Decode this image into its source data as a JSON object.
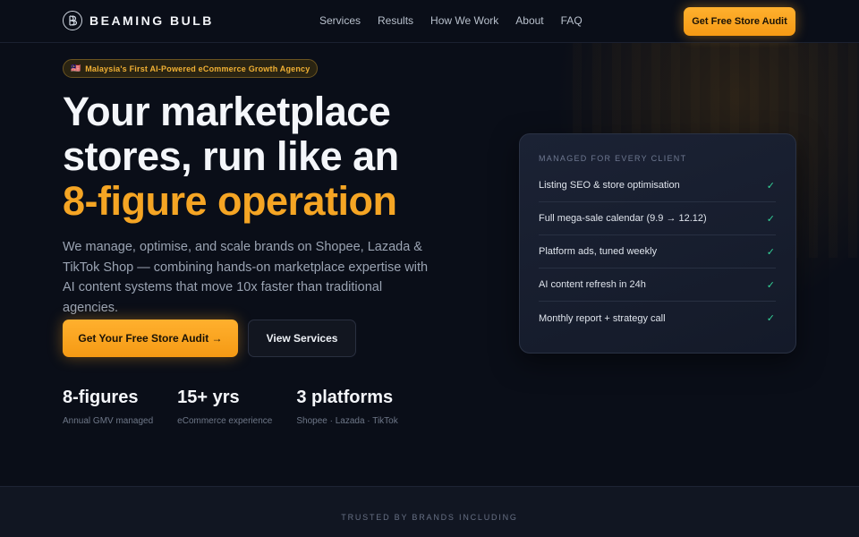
{
  "nav": {
    "brand": "BEAMING BULB",
    "links": [
      "Services",
      "Results",
      "How We Work",
      "About",
      "FAQ"
    ],
    "cta": "Get Free Store Audit"
  },
  "hero": {
    "badge_flag": "🇲🇾",
    "badge": "Malaysia's First AI-Powered eCommerce Growth Agency",
    "headline_part1": "Your marketplace stores, run like an ",
    "headline_accent": "8-figure operation",
    "subtext": "We manage, optimise, and scale brands on Shopee, Lazada & TikTok Shop — combining hands-on marketplace expertise with AI content systems that move 10x faster than traditional agencies.",
    "primary_cta": "Get Your Free Store Audit →",
    "secondary_cta": "View Services"
  },
  "stats": [
    {
      "value": "8-figures",
      "label": "Annual GMV managed"
    },
    {
      "value": "15+ yrs",
      "label": "eCommerce experience"
    },
    {
      "value": "3 platforms",
      "label": "Shopee · Lazada · TikTok"
    }
  ],
  "card": {
    "title": "MANAGED FOR EVERY CLIENT",
    "items": [
      "Listing SEO & store optimisation",
      "Full mega-sale calendar (9.9 → 12.12)",
      "Platform ads, tuned weekly",
      "AI content refresh in 24h",
      "Monthly report + strategy call"
    ],
    "check": "✓"
  },
  "trusted": {
    "label": "TRUSTED BY BRANDS INCLUDING"
  },
  "colors": {
    "accent": "#f5a524",
    "background": "#0a0e18",
    "check": "#34d399"
  }
}
